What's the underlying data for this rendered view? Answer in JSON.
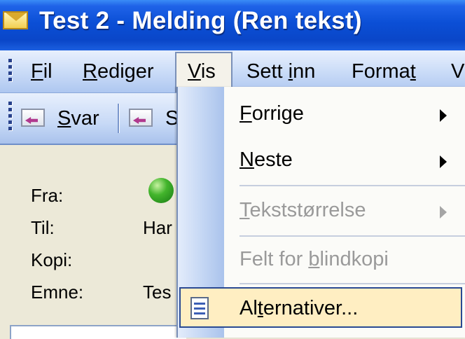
{
  "window": {
    "title": "Test 2 - Melding (Ren tekst)",
    "icon": "envelope-icon"
  },
  "menubar": {
    "items": [
      {
        "mn": "F",
        "rest": "il"
      },
      {
        "mn": "R",
        "rest": "ediger"
      },
      {
        "mn": "V",
        "rest": "is"
      },
      {
        "pre": "Sett ",
        "mn": "i",
        "rest": "nn"
      },
      {
        "pre": "Forma",
        "mn": "t",
        "rest": ""
      },
      {
        "label": "V"
      }
    ]
  },
  "toolbar": {
    "reply": {
      "mn": "S",
      "rest": "var",
      "icon": "reply-envelope-icon"
    },
    "reply_all": {
      "label": "S",
      "icon": "reply-all-envelope-icon"
    }
  },
  "header": {
    "fields": [
      {
        "label": "Fra:",
        "value": ""
      },
      {
        "label": "Til:",
        "value": "Har"
      },
      {
        "label": "Kopi:",
        "value": ""
      },
      {
        "label": "Emne:",
        "value": "Tes"
      }
    ],
    "status_icon": "presence-online-icon"
  },
  "dropdown": {
    "items": [
      {
        "mn": "F",
        "rest": "orrige",
        "submenu": true,
        "enabled": true
      },
      {
        "mn": "N",
        "rest": "este",
        "submenu": true,
        "enabled": true
      },
      {
        "mn": "T",
        "rest": "ekststørrelse",
        "submenu": true,
        "enabled": false
      },
      {
        "pre": "Felt for ",
        "mn": "b",
        "rest": "lindkopi",
        "submenu": false,
        "enabled": false
      },
      {
        "pre": "Al",
        "mn": "t",
        "rest": "ernativer...",
        "submenu": false,
        "enabled": true,
        "highlighted": true,
        "icon": "options-icon"
      }
    ]
  },
  "colors": {
    "title_bar": "#0b4fd6",
    "highlight": "#ffeec2",
    "highlight_border": "#2a4a93",
    "disabled_text": "#9a9a9a"
  }
}
